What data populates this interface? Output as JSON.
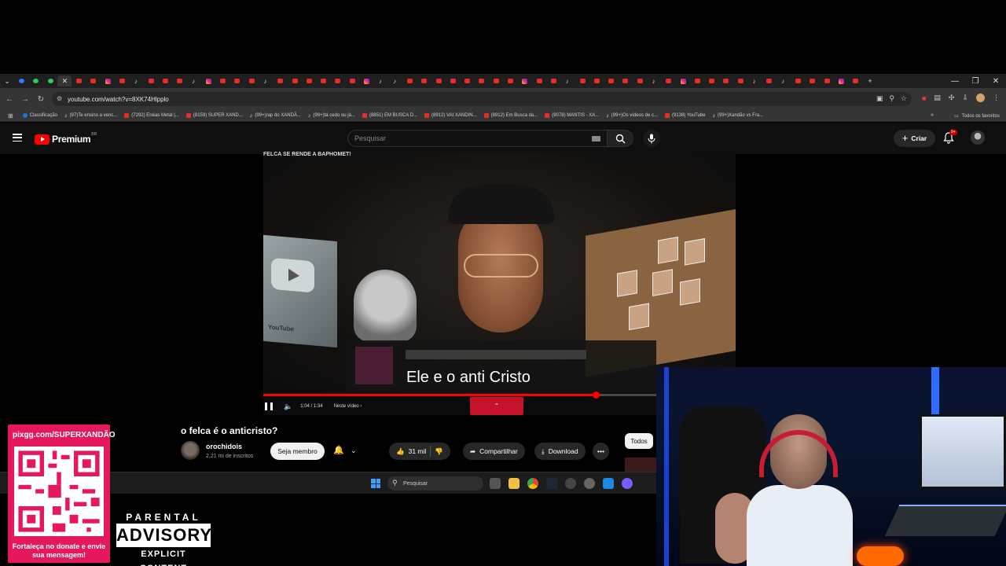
{
  "browser": {
    "url": "youtube.com/watch?v=8XK74Hlpplo",
    "tab_count": 60,
    "bookmarks": [
      {
        "label": "Classificação",
        "icon": "blue"
      },
      {
        "label": "(97)Te ensino a venc...",
        "icon": "tiktok"
      },
      {
        "label": "(7292) Enéas Metal |...",
        "icon": "youtube"
      },
      {
        "label": "(8159) SUPER XAND...",
        "icon": "youtube"
      },
      {
        "label": "(99+)rap do XANDÃ...",
        "icon": "tiktok"
      },
      {
        "label": "(99+)tá cedo ou já...",
        "icon": "tiktok"
      },
      {
        "label": "(8851) EM BUSCA D...",
        "icon": "youtube"
      },
      {
        "label": "(8912) VAI XANDIN...",
        "icon": "youtube"
      },
      {
        "label": "(8912) Em Busca da...",
        "icon": "youtube"
      },
      {
        "label": "(9078) MANTIS - XA...",
        "icon": "youtube"
      },
      {
        "label": "(99+)Os vídeos de c...",
        "icon": "tiktok"
      },
      {
        "label": "(9138) YouTube",
        "icon": "youtube"
      },
      {
        "label": "(99+)Xandão vs Fra...",
        "icon": "tiktok"
      }
    ],
    "all_bookmarks_label": "Todos os favoritos"
  },
  "youtube": {
    "logo_word": "Premium",
    "logo_country": "BR",
    "search_placeholder": "Pesquisar",
    "create_label": "Criar",
    "notification_badge": "9+",
    "video": {
      "overlay_title": "FELCA SE RENDE A BAPHOMET!",
      "caption": "Ele e o anti Cristo",
      "silver_play_label": "YouTube",
      "time": "1:04 / 1:34",
      "next_label": "Neste vídeo ›",
      "progress": 0.7
    },
    "title": "o felca é o anticristo?",
    "channel_name": "orochidois",
    "channel_subs": "2,21 mi de inscritos",
    "member_label": "Seja membro",
    "likes": "31 mil",
    "share_label": "Compartilhar",
    "download_label": "Download",
    "more_label": "•••",
    "filter_label": "Todos"
  },
  "taskbar": {
    "search_placeholder": "Pesquisar"
  },
  "overlays": {
    "pix_url": "pixgg.com/SUPERXANDÃO",
    "pix_message": "Fortaleça no donate e envie sua mensagem!",
    "advisory_line1": "PARENTAL",
    "advisory_line2": "ADVISORY",
    "advisory_line3": "EXPLICIT CONTENT"
  },
  "colors": {
    "youtube_red": "#ff0000",
    "pix_pink": "#e5175f",
    "dark_bg": "#0f0f0f"
  }
}
